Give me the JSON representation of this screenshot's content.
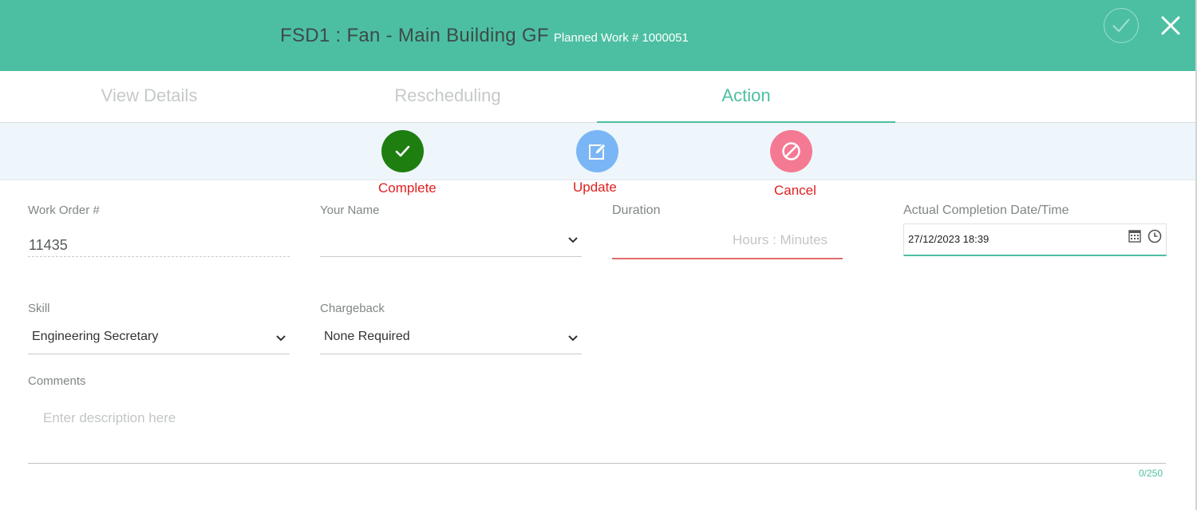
{
  "header": {
    "title": "FSD1 : Fan - Main Building GF",
    "subtitle": "Planned Work # 1000051",
    "confirm_icon": "check-circle-icon",
    "close_icon": "close-icon",
    "color": "#4cbfa2"
  },
  "tabs": [
    {
      "label": "View Details",
      "active": false
    },
    {
      "label": "Rescheduling",
      "active": false
    },
    {
      "label": "Action",
      "active": true
    }
  ],
  "actions": [
    {
      "label": "Complete",
      "icon": "check-icon",
      "color": "#1e7e10"
    },
    {
      "label": "Update",
      "icon": "edit-icon",
      "color": "#7ab6f5"
    },
    {
      "label": "Cancel",
      "icon": "cancel-icon",
      "color": "#f47a93"
    }
  ],
  "form": {
    "work_order": {
      "label": "Work Order #",
      "value": "11435"
    },
    "your_name": {
      "label": "Your Name",
      "value": ""
    },
    "duration": {
      "label": "Duration",
      "placeholder": "Hours : Minutes"
    },
    "completion": {
      "label": "Actual Completion Date/Time",
      "value": "27/12/2023 18:39"
    },
    "skill": {
      "label": "Skill",
      "value": "Engineering Secretary"
    },
    "chargeback": {
      "label": "Chargeback",
      "value": "None Required"
    },
    "comments": {
      "label": "Comments",
      "placeholder": "Enter description here",
      "counter": "0/250"
    }
  }
}
